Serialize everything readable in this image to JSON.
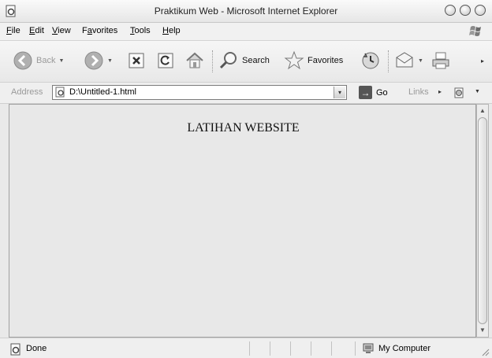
{
  "window": {
    "title": "Praktikum Web - Microsoft Internet Explorer"
  },
  "menu": {
    "items": [
      {
        "accel": "F",
        "rest": "ile"
      },
      {
        "accel": "E",
        "rest": "dit"
      },
      {
        "accel": "V",
        "rest": "iew"
      },
      {
        "pre": "F",
        "accel": "a",
        "rest": "vorites"
      },
      {
        "accel": "T",
        "rest": "ools"
      },
      {
        "accel": "H",
        "rest": "elp"
      }
    ]
  },
  "toolbar": {
    "back_label": "Back",
    "search_label": "Search",
    "favorites_label": "Favorites"
  },
  "address": {
    "label": "Address",
    "url": "D:\\Untitled-1.html",
    "go_label": "Go",
    "links_label": "Links"
  },
  "page": {
    "heading": "LATIHAN WEBSITE"
  },
  "status": {
    "text": "Done",
    "zone": "My Computer"
  },
  "icons": [
    "ie-page-icon",
    "windows-flag-icon",
    "back-arrow-icon",
    "forward-arrow-icon",
    "stop-icon",
    "refresh-icon",
    "home-icon",
    "search-magnifier-icon",
    "favorites-star-icon",
    "history-icon",
    "mail-icon",
    "print-icon",
    "go-arrow-icon",
    "my-computer-icon"
  ],
  "colors": {
    "chrome": "#e9e9e9",
    "content": "#e8e8e8",
    "titlebar": "#f0f0f0"
  }
}
